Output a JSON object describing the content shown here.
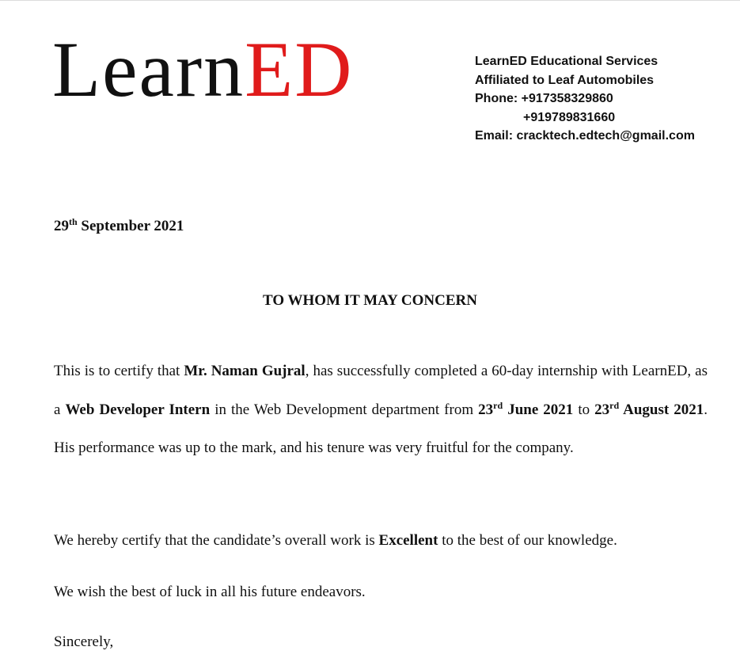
{
  "logo": {
    "learn": "Learn",
    "ed": "ED"
  },
  "contact": {
    "org": "LearnED Educational Services",
    "affiliation": "Affiliated to Leaf Automobiles",
    "phone_label": "Phone: ",
    "phone1": "+917358329860",
    "phone2": "+919789831660",
    "email_label": "Email: ",
    "email": "cracktech.edtech@gmail.com"
  },
  "date": {
    "day": "29",
    "suffix": "th",
    "rest": " September 2021"
  },
  "heading": "TO WHOM IT MAY CONCERN",
  "body": {
    "p1": {
      "t1": "This is to certify that ",
      "name": "Mr. Naman Gujral",
      "t2": ", has successfully completed a 60-day internship with LearnED, as a ",
      "role": "Web Developer Intern",
      "t3": " in the Web Development department from ",
      "start_day": "23",
      "start_suffix": "rd",
      "start_rest": " June 2021",
      "t4": " to ",
      "end_day": "23",
      "end_suffix": "rd",
      "end_rest": " August 2021",
      "t5": ". His performance was up to the mark, and his tenure was very fruitful for the company."
    },
    "p2": {
      "t1": "We hereby certify that the candidate’s overall work is ",
      "rating": "Excellent",
      "t2": " to the best of our knowledge."
    },
    "p3": "We wish the best of luck in all his future endeavors."
  },
  "closing": "Sincerely,"
}
